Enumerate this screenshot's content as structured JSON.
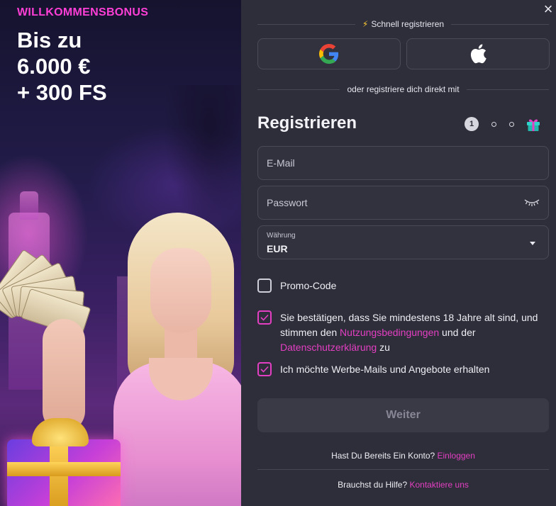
{
  "promo": {
    "badge": "WILLKOMMENSBONUS",
    "headline_line1": "Bis zu",
    "headline_line2": "6.000 €",
    "headline_line3": "+ 300 FS"
  },
  "form": {
    "quick_register": "Schnell registrieren",
    "or_direct": "oder registriere dich direkt mit",
    "social": [
      {
        "name": "google",
        "icon": "google-icon"
      },
      {
        "name": "apple",
        "icon": "apple-icon"
      }
    ],
    "title": "Registrieren",
    "steps": {
      "current": "1",
      "total_dots": 2,
      "final_icon": "gift-icon"
    },
    "email": {
      "placeholder": "E-Mail",
      "value": ""
    },
    "password": {
      "placeholder": "Passwort",
      "value": ""
    },
    "currency": {
      "label": "Währung",
      "value": "EUR"
    },
    "promo_code": {
      "label": "Promo-Code",
      "checked": false
    },
    "terms": {
      "checked": true,
      "text_before": "Sie bestätigen, dass Sie mindestens 18 Jahre alt sind, und stimmen den ",
      "terms_link": "Nutzungsbedingungen",
      "text_middle": " und der",
      "privacy_link": "Datenschutzerklärung",
      "text_after": " zu"
    },
    "marketing": {
      "checked": true,
      "label": "Ich möchte Werbe-Mails und Angebote erhalten"
    },
    "submit_label": "Weiter",
    "login_prompt": "Hast Du Bereits Ein Konto?",
    "login_link": "Einloggen",
    "help_prompt": "Brauchst du Hilfe?",
    "help_link": "Kontaktiere uns"
  },
  "colors": {
    "accent": "#e33fc2",
    "badge": "#ff3fd6",
    "panel": "#2e2e3a"
  }
}
